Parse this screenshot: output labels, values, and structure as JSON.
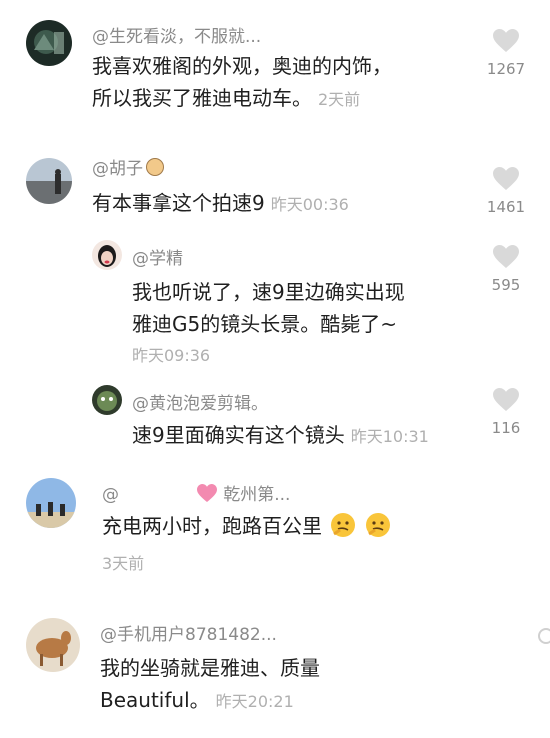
{
  "comments": [
    {
      "author": "@生死看淡，不服就...",
      "line1": "我喜欢雅阁的外观，奥迪的内饰，",
      "line2": "所以我买了雅迪电动车。",
      "time": "2天前",
      "likes": "1267"
    },
    {
      "author": "@胡子",
      "line1": "有本事拿这个拍速9",
      "time": "昨天00:36",
      "likes": "1461"
    }
  ],
  "replies": [
    {
      "author": "@学精",
      "line1": "我也听说了，速9里边确实出现",
      "line2": "雅迪G5的镜头长景。酷毙了~",
      "time": "昨天09:36",
      "likes": "595"
    },
    {
      "author": "@黄泡泡爱剪辑。",
      "line1": "速9里面确实有这个镜头",
      "time": "昨天10:31",
      "likes": "116"
    }
  ],
  "more": [
    {
      "author_prefix": "@",
      "author_suffix": "乾州第...",
      "line1": "充电两小时，跑路百公里",
      "time": "3天前"
    },
    {
      "author": "@手机用户8781482...",
      "line1": "我的坐骑就是雅迪、质量",
      "line2": "Beautiful。",
      "time": "昨天20:21"
    }
  ],
  "icons": {
    "like": "heart-icon",
    "face": "thinking-face-emoji",
    "heart_emoji": "sparkling-heart-emoji"
  },
  "colors": {
    "text": "#1f1f1f",
    "meta": "#8a8a8a",
    "time": "#b0b0b0",
    "like": "#d9d9d9"
  }
}
